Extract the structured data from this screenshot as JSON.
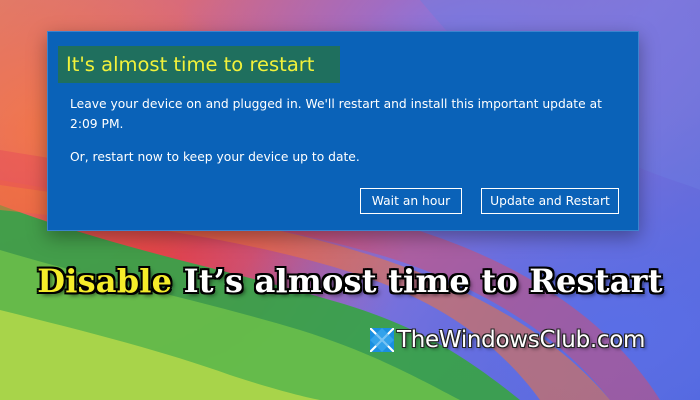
{
  "dialog": {
    "title": "It's almost time to restart",
    "message": "Leave your device on and plugged in. We'll restart and install this important update at 2:09 PM.",
    "message2": "Or, restart now to keep your device up to date.",
    "buttons": {
      "wait": "Wait an hour",
      "update": "Update and Restart"
    }
  },
  "headline": {
    "part1": "Disable",
    "part2": "It’s almost time to Restart"
  },
  "brand": {
    "text": "TheWindowsClub.com",
    "logo_icon": "windows-club-logo-icon"
  },
  "colors": {
    "dialog_bg": "#0a62b8",
    "title_bg": "#1f6f5e",
    "title_text": "#f2f23a",
    "headline_yellow": "#f5ec2a"
  }
}
